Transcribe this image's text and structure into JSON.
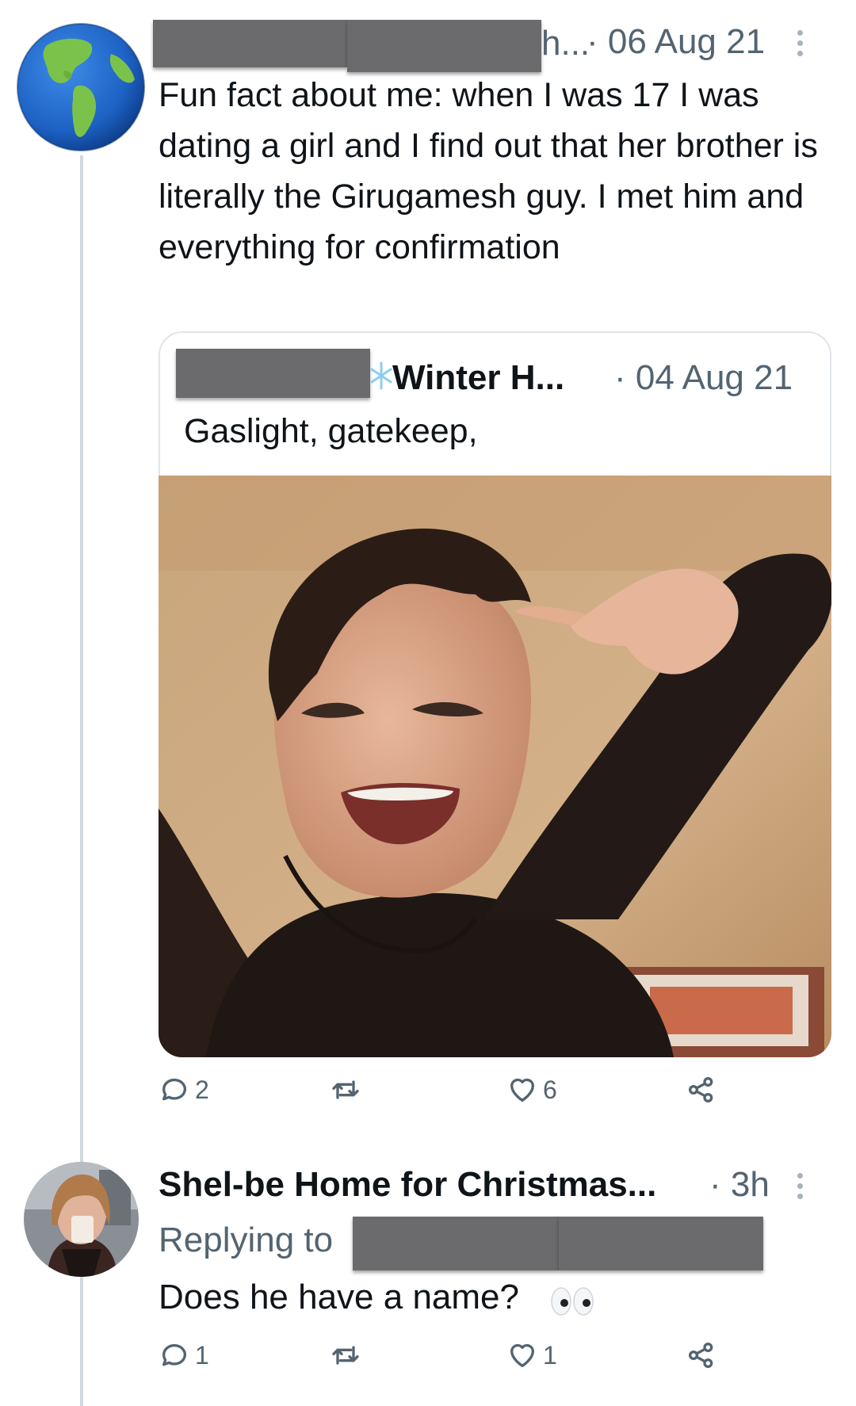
{
  "main_tweet": {
    "author_name_tail": "h...",
    "date": "· 06 Aug 21",
    "text": "Fun fact about me: when I was 17 I was dating a girl and I find out that her brother is literally the Girugamesh guy. I met him and everything for confirmation",
    "avatar_icon": "globe-earth-icon",
    "quoted": {
      "author_name": "Winter H...",
      "date": "· 04 Aug 21",
      "text": "Gaslight, gatekeep,",
      "snowflake_icon": "snowflake-icon"
    },
    "actions": {
      "reply_count": "2",
      "retweet_count": "",
      "like_count": "6"
    }
  },
  "reply_tweet": {
    "author_name": "Shel-be Home for Christmas...",
    "time": "· 3h",
    "replying_to": "Replying to",
    "text": "Does he have a name?",
    "emoji_icon": "eyes-icon",
    "actions": {
      "reply_count": "1",
      "retweet_count": "",
      "like_count": "1"
    }
  },
  "colors": {
    "text": "#0f1419",
    "muted": "#536471",
    "thread_line": "#cfd9de",
    "redaction": "#6b6b6e",
    "accent_blue": "#1d9bf0"
  }
}
